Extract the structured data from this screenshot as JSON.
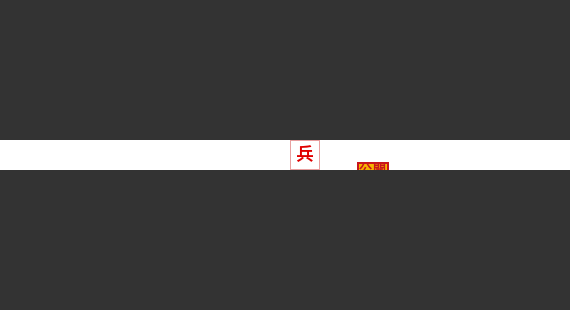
{
  "board": {
    "background_color": "#333333",
    "strip_color": "#ffffff"
  },
  "piece": {
    "label": "兵",
    "color": "#e00000",
    "side": "red"
  },
  "marker": {
    "label": "公開",
    "fill_color": "#f6b400",
    "border_color": "#c8161d"
  }
}
